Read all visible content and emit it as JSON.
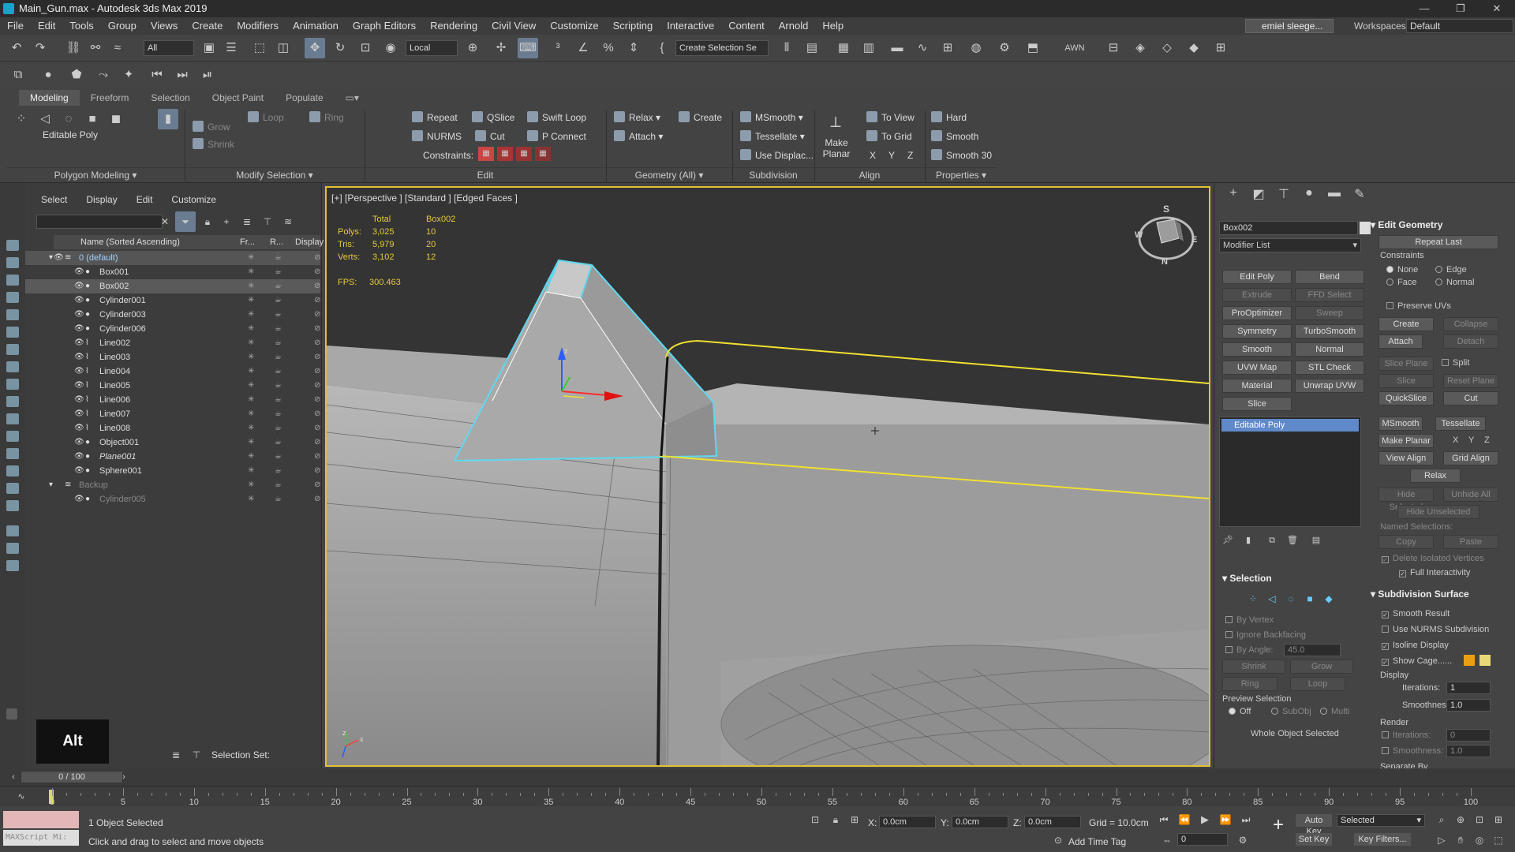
{
  "window": {
    "title": "Main_Gun.max - Autodesk 3ds Max 2019",
    "controls": [
      "—",
      "❐",
      "✕"
    ]
  },
  "menu": [
    "File",
    "Edit",
    "Tools",
    "Group",
    "Views",
    "Create",
    "Modifiers",
    "Animation",
    "Graph Editors",
    "Rendering",
    "Civil View",
    "Customize",
    "Scripting",
    "Interactive",
    "Content",
    "Arnold",
    "Help"
  ],
  "account": {
    "user": "emiel sleege...",
    "workspaces_label": "Workspaces:",
    "workspace": "Default"
  },
  "toolbar": {
    "filter": "All",
    "coord": "Local",
    "selection_set": "Create Selection Se",
    "awn": "AWN"
  },
  "ribbon": {
    "tabs": [
      "Modeling",
      "Freeform",
      "Selection",
      "Object Paint",
      "Populate"
    ],
    "editable_poly": "Editable Poly",
    "grow": "Grow",
    "shrink": "Shrink",
    "loop": "Loop",
    "ring": "Ring",
    "edit": {
      "repeat": "Repeat",
      "qslice": "QSlice",
      "swift_loop": "Swift Loop",
      "nurms": "NURMS",
      "cut": "Cut",
      "p_connect": "P Connect",
      "constraints": "Constraints:"
    },
    "geometry": {
      "relax": "Relax",
      "create": "Create",
      "attach": "Attach"
    },
    "subdivision": {
      "msmooth": "MSmooth",
      "tessellate": "Tessellate",
      "use_displac": "Use Displac..."
    },
    "align": {
      "make_planar": "Make Planar",
      "to_view": "To View",
      "to_grid": "To Grid",
      "x": "X",
      "y": "Y",
      "z": "Z"
    },
    "properties": {
      "hard": "Hard",
      "smooth": "Smooth",
      "smooth30": "Smooth 30"
    },
    "groups": [
      "Polygon Modeling",
      "Modify Selection",
      "Edit",
      "Geometry (All)",
      "Subdivision",
      "Align",
      "Properties"
    ]
  },
  "scene": {
    "tabs": [
      "Select",
      "Display",
      "Edit",
      "Customize"
    ],
    "headers": [
      "Name (Sorted Ascending)",
      "Fr...",
      "R...",
      "Display a..."
    ],
    "rows": [
      {
        "name": "0 (default)",
        "type": "layer"
      },
      {
        "name": "Box001",
        "type": "obj"
      },
      {
        "name": "Box002",
        "type": "obj",
        "sel": true
      },
      {
        "name": "Cylinder001",
        "type": "obj"
      },
      {
        "name": "Cylinder003",
        "type": "obj"
      },
      {
        "name": "Cylinder006",
        "type": "obj"
      },
      {
        "name": "Line002",
        "type": "shape"
      },
      {
        "name": "Line003",
        "type": "shape"
      },
      {
        "name": "Line004",
        "type": "shape"
      },
      {
        "name": "Line005",
        "type": "shape"
      },
      {
        "name": "Line006",
        "type": "shape"
      },
      {
        "name": "Line007",
        "type": "shape"
      },
      {
        "name": "Line008",
        "type": "shape"
      },
      {
        "name": "Object001",
        "type": "obj"
      },
      {
        "name": "Plane001",
        "type": "obj",
        "italic": true
      },
      {
        "name": "Sphere001",
        "type": "obj"
      },
      {
        "name": "Backup",
        "type": "layer2"
      },
      {
        "name": "Cylinder005",
        "type": "obj2"
      }
    ],
    "alt_key": "Alt",
    "selection_set_label": "Selection Set:"
  },
  "viewport": {
    "label": "[+] [Perspective ] [Standard ] [Edged Faces ]",
    "stats": {
      "total": "Total",
      "object": "Box002",
      "polys_label": "Polys:",
      "polys_total": "3,025",
      "polys_obj": "10",
      "tris_label": "Tris:",
      "tris_total": "5,979",
      "tris_obj": "20",
      "verts_label": "Verts:",
      "verts_total": "3,102",
      "verts_obj": "12",
      "fps_label": "FPS:",
      "fps": "300.463"
    },
    "viewcube": {
      "s": "S",
      "w": "W",
      "e": "E",
      "n": "N"
    },
    "axis": {
      "x": "x",
      "z": "z"
    }
  },
  "command_panel": {
    "object_name": "Box002",
    "modifier_list": "Modifier List",
    "buttons": [
      [
        "Edit Poly",
        "Bend"
      ],
      [
        "Extrude",
        "FFD Select"
      ],
      [
        "ProOptimizer",
        "Sweep"
      ],
      [
        "Symmetry",
        "TurboSmooth"
      ],
      [
        "Smooth",
        "Normal"
      ],
      [
        "UVW Map",
        "STL Check"
      ],
      [
        "Material",
        "Unwrap UVW"
      ],
      [
        "Slice",
        ""
      ]
    ],
    "stack_item": "Editable Poly",
    "selection": {
      "title": "Selection",
      "by_vertex": "By Vertex",
      "ignore_backfacing": "Ignore Backfacing",
      "by_angle": "By Angle:",
      "angle": "45.0",
      "shrink": "Shrink",
      "grow": "Grow",
      "ring": "Ring",
      "loop": "Loop",
      "preview": "Preview Selection",
      "off": "Off",
      "subobj": "SubObj",
      "multi": "Multi",
      "whole": "Whole Object Selected"
    },
    "edit_geometry": {
      "title": "Edit Geometry",
      "repeat_last": "Repeat Last",
      "constraints": "Constraints",
      "none": "None",
      "edge": "Edge",
      "face": "Face",
      "normal": "Normal",
      "preserve_uvs": "Preserve UVs",
      "create": "Create",
      "collapse": "Collapse",
      "attach": "Attach",
      "detach": "Detach",
      "slice_plane": "Slice Plane",
      "split": "Split",
      "slice": "Slice",
      "reset_plane": "Reset Plane",
      "quickslice": "QuickSlice",
      "cut": "Cut",
      "msmooth": "MSmooth",
      "tessellate": "Tessellate",
      "make_planar": "Make Planar",
      "x": "X",
      "y": "Y",
      "z": "Z",
      "view_align": "View Align",
      "grid_align": "Grid Align",
      "relax": "Relax",
      "hide_selected": "Hide Selected",
      "unhide_all": "Unhide All",
      "hide_unselected": "Hide Unselected",
      "named_selections": "Named Selections:",
      "copy": "Copy",
      "paste": "Paste",
      "delete_isolated": "Delete Isolated Vertices",
      "full_interactivity": "Full Interactivity"
    },
    "subdivision": {
      "title": "Subdivision Surface",
      "smooth_result": "Smooth Result",
      "use_nurms": "Use NURMS Subdivision",
      "isoline": "Isoline Display",
      "show_cage": "Show Cage......",
      "display": "Display",
      "iterations_label": "Iterations:",
      "iterations": "1",
      "smoothness_label": "Smoothness:",
      "smoothness": "1.0",
      "render": "Render",
      "r_iterations": "0",
      "r_smoothness": "1.0",
      "separate_by": "Separate By"
    }
  },
  "timeline": {
    "frame": "0 / 100",
    "ticks": [
      "0",
      "5",
      "10",
      "15",
      "20",
      "25",
      "30",
      "35",
      "40",
      "45",
      "50",
      "55",
      "60",
      "65",
      "70",
      "75",
      "80",
      "85",
      "90",
      "95",
      "100"
    ]
  },
  "status": {
    "maxscript": "MAXScript Mi:",
    "objects": "1 Object Selected",
    "hint": "Click and drag to select and move objects",
    "x_label": "X:",
    "x": "0.0cm",
    "y_label": "Y:",
    "y": "0.0cm",
    "z_label": "Z:",
    "z": "0.0cm",
    "grid": "Grid = 10.0cm",
    "add_time_tag": "Add Time Tag",
    "auto_key": "Auto Key",
    "selected": "Selected",
    "set_key": "Set Key",
    "key_filters": "Key Filters...",
    "frame": "0"
  },
  "colors": {
    "selection_cyan": "#5fd8f0",
    "edge_yellow": "#f0e030",
    "viewport_border": "#e3c132",
    "stats": "#e6c93a"
  }
}
